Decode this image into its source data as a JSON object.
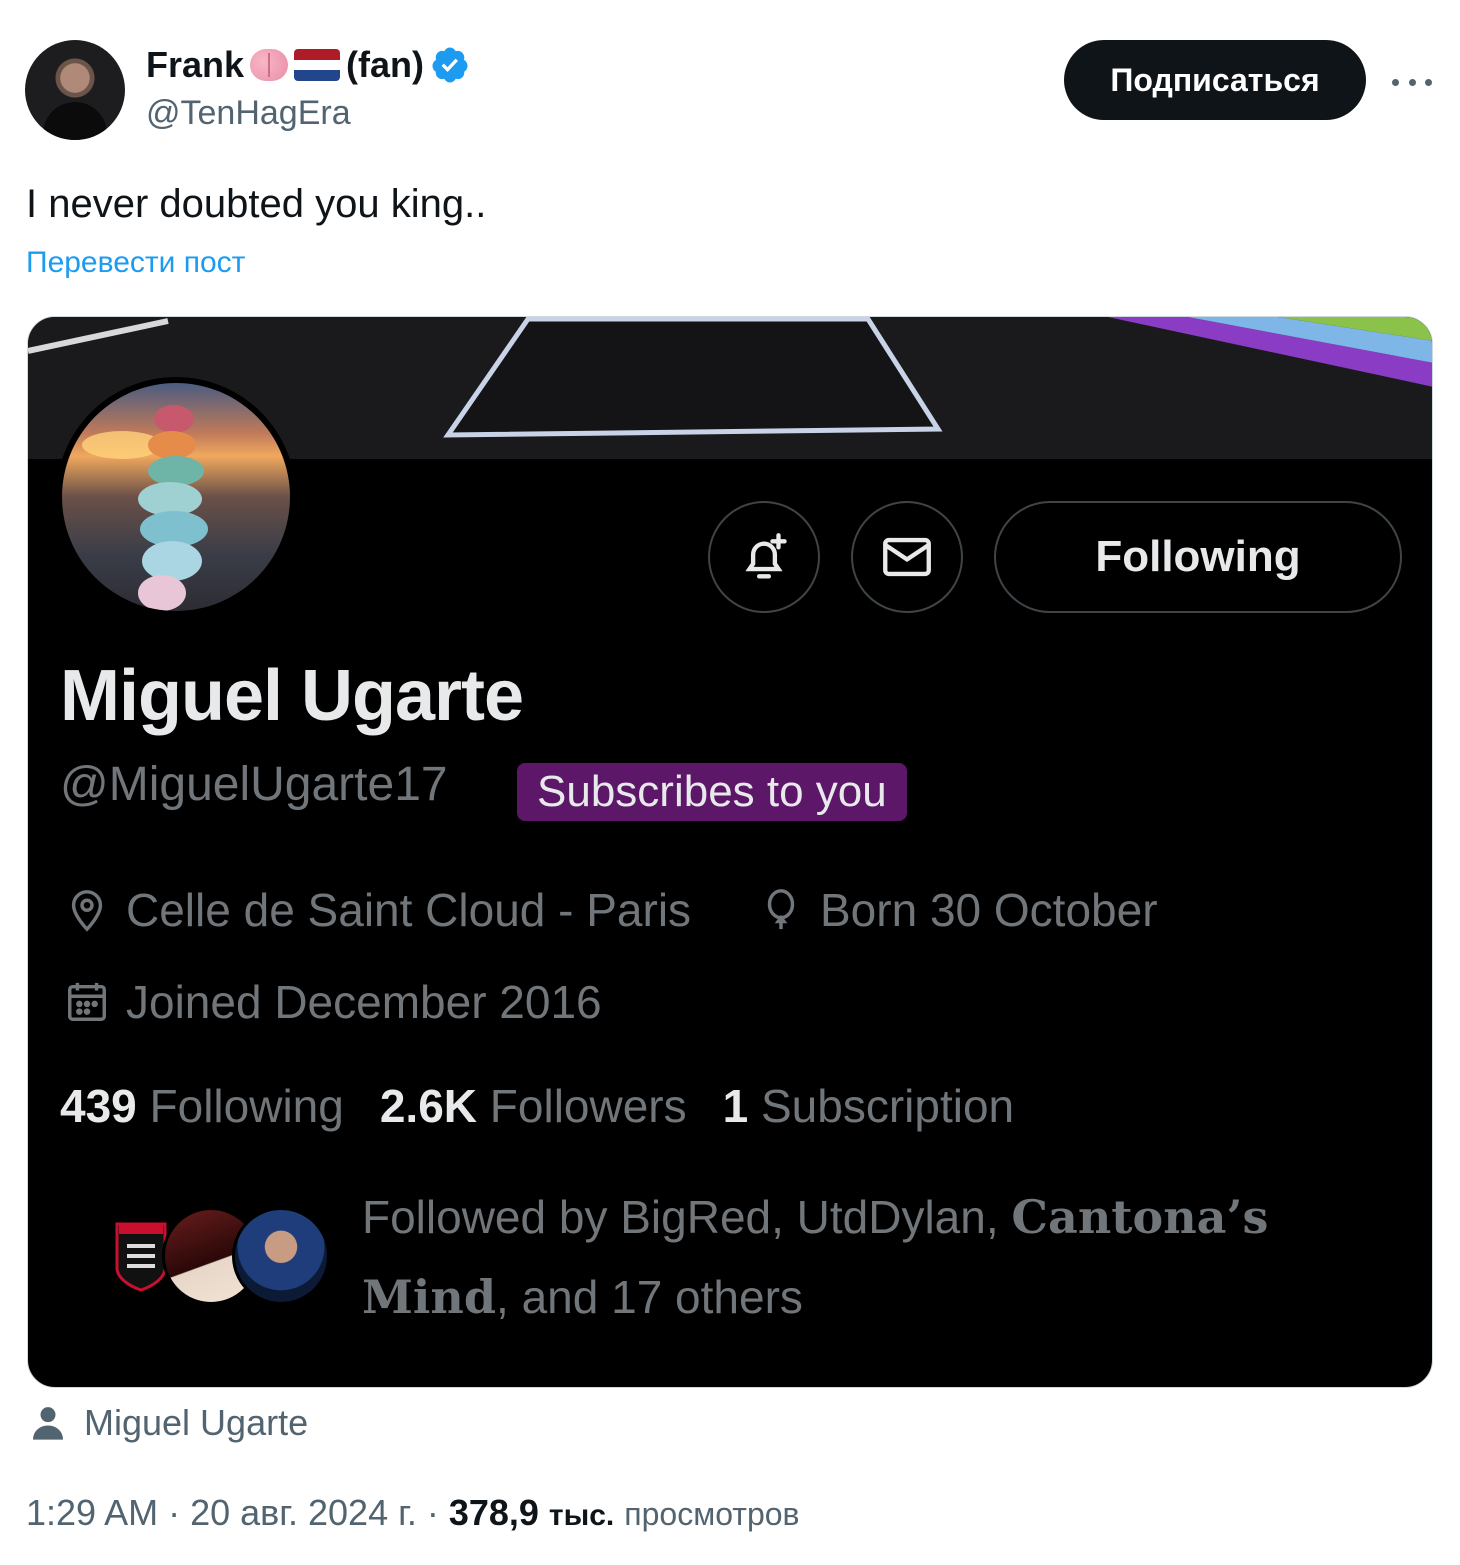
{
  "tweet": {
    "author_name": "Frank",
    "author_suffix": "(fan)",
    "author_handle": "@TenHagEra",
    "subscribe_label": "Подписаться",
    "text": "I never doubted you king..",
    "translate_label": "Перевести пост",
    "media_author": "Miguel Ugarte",
    "timestamp": "1:29 AM · 20 авг. 2024 г. ·",
    "views_count": "378,9",
    "views_unit": "тыс.",
    "views_label": "просмотров",
    "colors": {
      "accent": "#1d9bf0",
      "verified": "#1d9bf0",
      "flag": [
        "#ae1c28",
        "#ffffff",
        "#21468b"
      ]
    }
  },
  "profile": {
    "name": "Miguel Ugarte",
    "handle": "@MiguelUgarte17",
    "badge": "Subscribes to you",
    "following_button": "Following",
    "location": "Celle de Saint Cloud - Paris",
    "birthday": "Born 30 October",
    "joined": "Joined December 2016",
    "stats": {
      "following_count": "439",
      "following_label": "Following",
      "followers_count": "2.6K",
      "followers_label": "Followers",
      "subscriptions_count": "1",
      "subscriptions_label": "Subscription"
    },
    "followed_by": {
      "prefix": "Followed by BigRed, UtdDylan, ",
      "highlight": "Cantona’s Mind",
      "suffix": ", and 17 others"
    },
    "icons": [
      "bell-plus-icon",
      "mail-icon",
      "location-pin-icon",
      "balloon-icon",
      "calendar-icon"
    ],
    "colors": {
      "badge_bg": "#5d1769",
      "card_bg": "#000000"
    }
  }
}
